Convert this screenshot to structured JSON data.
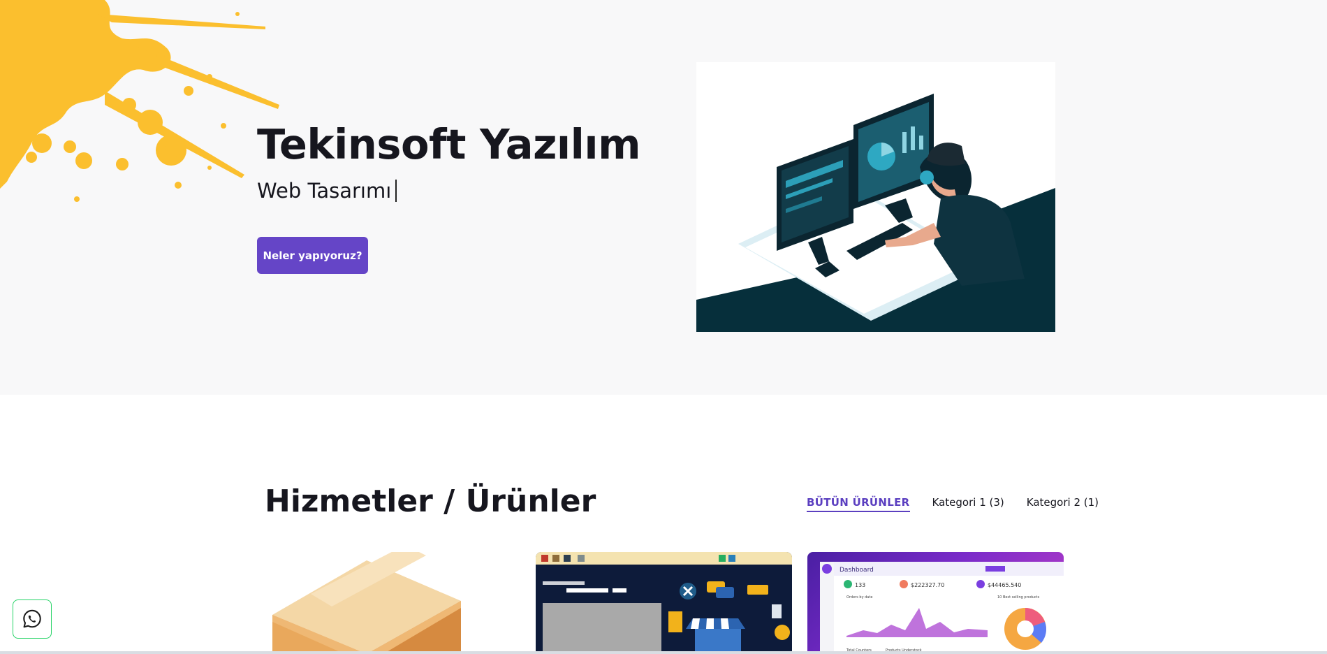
{
  "hero": {
    "title": "Tekinsoft Yazılım",
    "subtitle": "Web Tasarımı",
    "cta_label": "Neler yapıyoruz?",
    "splash_color": "#fbbf2e",
    "illustration": "developer-at-desk"
  },
  "products": {
    "title": "Hizmetler / Ürünler",
    "filters": [
      "BÜTÜN ÜRÜNLER",
      "Kategori 1 (3)",
      "Kategori 2 (1)"
    ],
    "active_filter": "BÜTÜN ÜRÜNLER",
    "cards": [
      {
        "image": "cardboard-box"
      },
      {
        "image": "pos-shop-screenshot"
      },
      {
        "image": "dashboard-screenshot",
        "heading": "Dashboard",
        "labels": [
          "Orders by date",
          "10 Best selling products",
          "Total Counters",
          "Products Understock"
        ],
        "stats": [
          "133",
          "$222327.70",
          "$44465.540"
        ]
      }
    ]
  },
  "whatsapp": {
    "icon": "whatsapp-icon"
  },
  "colors": {
    "accent": "#6545c7",
    "hero_bg": "#f8f8f9",
    "text": "#16161e"
  }
}
